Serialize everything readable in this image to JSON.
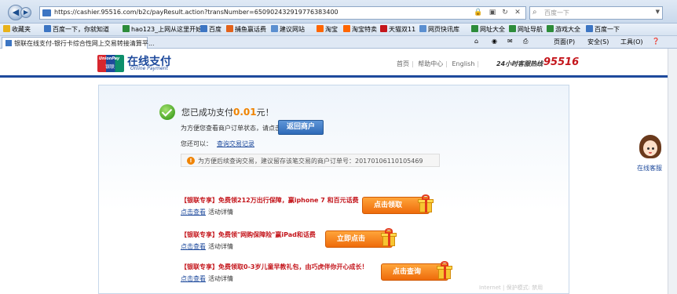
{
  "browser": {
    "url": "https://cashier.95516.com/b2c/payResult.action?transNumber=650902432919776383400",
    "search_placeholder": "百度一下",
    "favorites": [
      {
        "label": "收藏夹",
        "color": "#e8b21a"
      },
      {
        "label": "百度一下，你就知道",
        "color": "#3c75c3"
      },
      {
        "label": "hao123_上网从这里开始",
        "color": "#2d8c3a"
      },
      {
        "label": "百度",
        "color": "#3c75c3"
      },
      {
        "label": "捕鱼赢话费",
        "color": "#e2621b"
      },
      {
        "label": "建议网站",
        "color": "#5b8fd0"
      },
      {
        "label": "淘宝",
        "color": "#ff6600"
      },
      {
        "label": "淘宝特卖",
        "color": "#ff6600"
      },
      {
        "label": "天猫双11",
        "color": "#c4161c"
      },
      {
        "label": "网页快讯库",
        "color": "#5b8fd0"
      },
      {
        "label": "网址大全",
        "color": "#2d8c3a"
      },
      {
        "label": "网址导航",
        "color": "#2d8c3a"
      },
      {
        "label": "游戏大全",
        "color": "#2d8c3a"
      },
      {
        "label": "百度一下",
        "color": "#3c75c3"
      }
    ],
    "tools": {
      "page": "页面(P)",
      "safety": "安全(S)",
      "tools": "工具(O)",
      "help": "❓"
    },
    "tab_title": "银联在线支付-银行卡综合性网上交易转接清算平..."
  },
  "header": {
    "logo_brand": "UnionPay",
    "logo_brand_cn": "银联",
    "logo_title": "在线支付",
    "logo_subtitle": "Online Payment",
    "link_home": "首页",
    "link_help": "帮助中心",
    "link_lang": "English",
    "hotline_label": "24小时客服热线",
    "hotline_number": "95516"
  },
  "result": {
    "prefix": "您已成功支付",
    "amount": "0.01",
    "suffix": "元！",
    "check_status_text": "为方便您查看商户订单状态，请点击",
    "return_button": "返回商户",
    "also_label": "您还可以：",
    "also_link": "查询交易记录",
    "notice_icon": "!",
    "notice_text": "为方便后续查询交易，建议留存该笔交易的商户订单号：20170106110105469"
  },
  "promos": [
    {
      "tag": "【银联专享】",
      "title": "免费领212万出行保障，赢iphone 7 和百元话费",
      "link": "点击查看",
      "detail": "活动详情",
      "button": "点击领取"
    },
    {
      "tag": "【银联专享】",
      "title": "免费领\"网购保障险\"赢iPad和话费",
      "link": "点击查看",
      "detail": "活动详情",
      "button": "立即点击"
    },
    {
      "tag": "【银联专享】",
      "title": "免费领取0-3岁儿童早教礼包，由巧虎伴你开心成长！",
      "link": "点击查看",
      "detail": "活动详情",
      "button": "点击查询"
    }
  ],
  "service": {
    "label": "在线客服"
  },
  "status_bar": {
    "text": "Internet | 保护模式: 禁用"
  }
}
